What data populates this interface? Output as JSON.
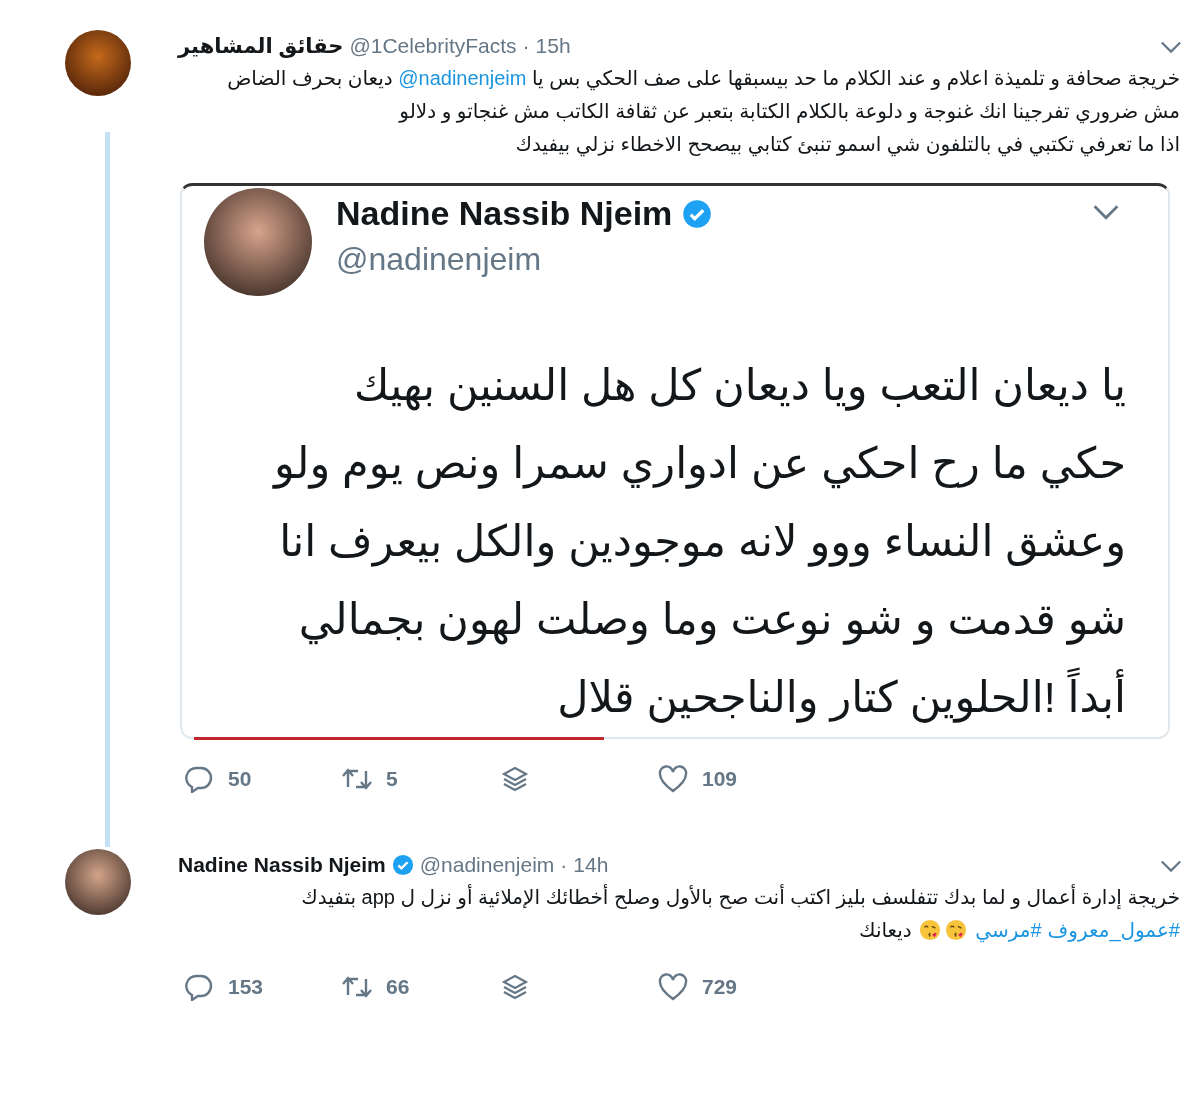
{
  "tweets": [
    {
      "author": "حقائق المشاهير",
      "verified": false,
      "handle": "@1CelebrityFacts",
      "separator": "·",
      "time": "15h",
      "paragraphs": [
        [
          {
            "kind": "text",
            "text": "خريجة صحافة و تلميذة اعلام و عند الكلام ما حد بيسبقها على صف الحكي بس يا "
          },
          {
            "kind": "mention",
            "text": "@nadinenjeim"
          },
          {
            "kind": "text",
            "text": " ديعان بحرف الضاض مش ضروري تفرجينا انك غنوجة و دلوعة بالكلام الكتابة بتعبر عن ثقافة الكاتب مش غنجاتو و دلالو"
          }
        ],
        [
          {
            "kind": "text",
            "text": "اذا ما تعرفي تكتبي في بالتلفون شي اسمو تنبئ كتابي بيصحح الاخطاء نزلي بيفيدك"
          }
        ]
      ],
      "quote": {
        "author": "Nadine Nassib Njeim",
        "verified": true,
        "handle": "@nadinenjeim",
        "lines": [
          "يا ديعان التعب ويا ديعان كل هل السنين بهيك",
          "حكي ما رح احكي عن ادواري سمرا ونص يوم ولو",
          "وعشق النساء ووو لانه موجودين والكل بيعرف انا",
          "شو قدمت و شو نوعت وما وصلت لهون بجمالي",
          "أبداً !الحلوين كتار والناجحين قلال"
        ]
      },
      "replies": "50",
      "retweets": "5",
      "likes": "109"
    },
    {
      "author": "Nadine Nassib Njeim",
      "verified": true,
      "handle": "@nadinenjeim",
      "separator": "·",
      "time": "14h",
      "paragraphs": [
        [
          {
            "kind": "text",
            "text": "خريجة إدارة أعمال و لما بدك تتفلسف بليز اكتب أنت صح بالأول وصلح أخطائك الإملائية أو نزل ل app بتفيدك "
          },
          {
            "kind": "hashtag",
            "text": "#عمول_معروف"
          },
          {
            "kind": "hashtag",
            "text": "#مرسي"
          },
          {
            "kind": "emoji"
          },
          {
            "kind": "emoji"
          },
          {
            "kind": "text",
            "text": " ديعانك"
          }
        ]
      ],
      "replies": "153",
      "retweets": "66",
      "likes": "729"
    }
  ]
}
